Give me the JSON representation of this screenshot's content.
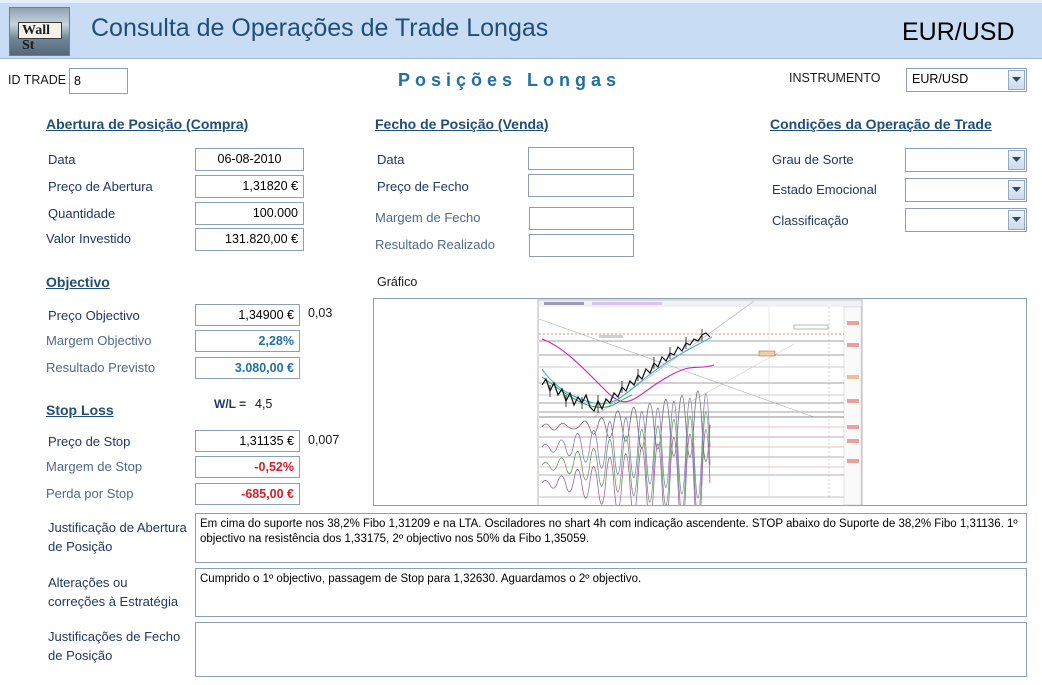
{
  "header": {
    "logo_text": "Wall St",
    "title": "Consulta de Operações de Trade Longas",
    "instrument_display": "EUR/USD"
  },
  "top": {
    "id_label": "ID TRADE",
    "id_value": "8",
    "heading": "Posições Longas",
    "instrument_label": "INSTRUMENTO",
    "instrument_value": "EUR/USD"
  },
  "opening": {
    "title": "Abertura de Posição (Compra)",
    "date_label": "Data",
    "date_value": "06-08-2010",
    "price_label": "Preço de Abertura",
    "price_value": "1,31820 €",
    "qty_label": "Quantidade",
    "qty_value": "100.000",
    "invested_label": "Valor Investido",
    "invested_value": "131.820,00 €"
  },
  "closing": {
    "title": "Fecho de Posição (Venda)",
    "date_label": "Data",
    "date_value": "",
    "price_label": "Preço de Fecho",
    "price_value": "",
    "margin_label": "Margem de Fecho",
    "margin_value": "",
    "result_label": "Resultado Realizado",
    "result_value": ""
  },
  "conditions": {
    "title": "Condições da Operação de Trade",
    "luck_label": "Grau de Sorte",
    "luck_value": "",
    "emotion_label": "Estado Emocional",
    "emotion_value": "",
    "class_label": "Classificação",
    "class_value": ""
  },
  "objective": {
    "title": "Objectivo",
    "price_label": "Preço Objectivo",
    "price_value": "1,34900 €",
    "price_diff": "0,03",
    "margin_label": "Margem Objectivo",
    "margin_value": "2,28%",
    "expected_label": "Resultado Previsto",
    "expected_value": "3.080,00 €"
  },
  "stop": {
    "title": "Stop Loss",
    "wl_label": "W/L =",
    "wl_value": "4,5",
    "price_label": "Preço de Stop",
    "price_value": "1,31135 €",
    "price_diff": "0,007",
    "margin_label": "Margem de Stop",
    "margin_value": "-0,52%",
    "loss_label": "Perda por Stop",
    "loss_value": "-685,00 €"
  },
  "chart": {
    "label": "Gráfico"
  },
  "notes": {
    "opening_label": "Justificação de Abertura de Posição",
    "opening_text": "Em cima do suporte nos 38,2% Fibo 1,31209 e na LTA. Osciladores no shart 4h com indicação ascendente. STOP abaixo do Suporte de 38,2% Fibo 1,31136. 1º objectivo na resistência dos 1,33175, 2º objectivo nos 50% da Fibo 1,35059.",
    "changes_label": "Alterações ou correções à Estratégia",
    "changes_text": "Cumprido o 1º objectivo, passagem de Stop para 1,32630. Aguardamos o 2º objectivo.",
    "closing_label": "Justificações de Fecho de Posição",
    "closing_text": ""
  },
  "colors": {
    "header_bg": "#c8dcf4",
    "label_text": "#1f3864",
    "positive_value": "#1f6fa8",
    "negative_value": "#d4202a"
  }
}
